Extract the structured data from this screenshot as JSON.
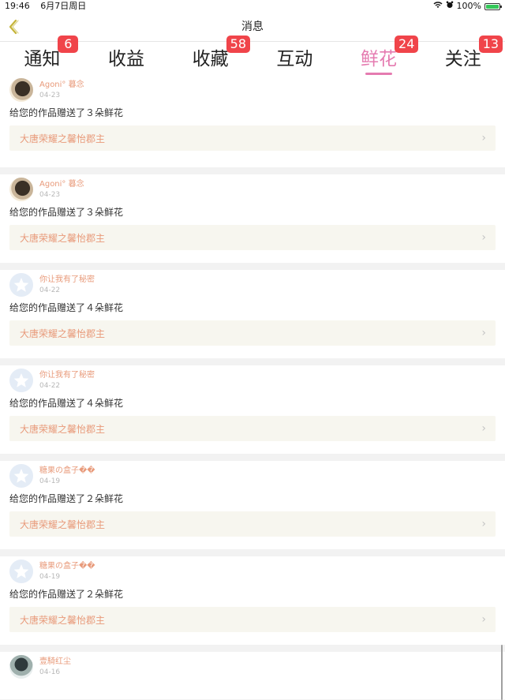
{
  "status_bar": {
    "time": "19:46",
    "date": "6月7日周日",
    "battery_percent": "100%",
    "battery_level": 1.0
  },
  "nav": {
    "title": "消息",
    "back_icon": "chevron-left-icon",
    "back_color": "#c5b43a"
  },
  "tabs": [
    {
      "label": "通知",
      "badge": "6"
    },
    {
      "label": "收益",
      "badge": ""
    },
    {
      "label": "收藏",
      "badge": "58"
    },
    {
      "label": "互动",
      "badge": ""
    },
    {
      "label": "鲜花",
      "badge": "24",
      "active": true
    },
    {
      "label": "关注",
      "badge": "13"
    }
  ],
  "colors": {
    "accent_pink": "#e57bb0",
    "badge_red": "#f0444a",
    "name_orange": "#e89a7a"
  },
  "items": [
    {
      "name": "Agoni° 暮念",
      "date": "04-23",
      "message": "给您的作品赠送了３朵鲜花",
      "work": "大唐荣耀之馨怡郡主",
      "avatar": "photo"
    },
    {
      "name": "Agoni° 暮念",
      "date": "04-23",
      "message": "给您的作品赠送了３朵鲜花",
      "work": "大唐荣耀之馨怡郡主",
      "avatar": "photo"
    },
    {
      "name": "你让我有了秘密",
      "date": "04-22",
      "message": "给您的作品赠送了４朵鲜花",
      "work": "大唐荣耀之馨怡郡主",
      "avatar": "default"
    },
    {
      "name": "你让我有了秘密",
      "date": "04-22",
      "message": "给您的作品赠送了４朵鲜花",
      "work": "大唐荣耀之馨怡郡主",
      "avatar": "default"
    },
    {
      "name": "糖果の盒子��",
      "date": "04-19",
      "message": "给您的作品赠送了２朵鲜花",
      "work": "大唐荣耀之馨怡郡主",
      "avatar": "default"
    },
    {
      "name": "糖果の盒子��",
      "date": "04-19",
      "message": "给您的作品赠送了２朵鲜花",
      "work": "大唐荣耀之馨怡郡主",
      "avatar": "default"
    }
  ],
  "partial_item": {
    "name": "壹騎红尘",
    "date": "04-16"
  }
}
